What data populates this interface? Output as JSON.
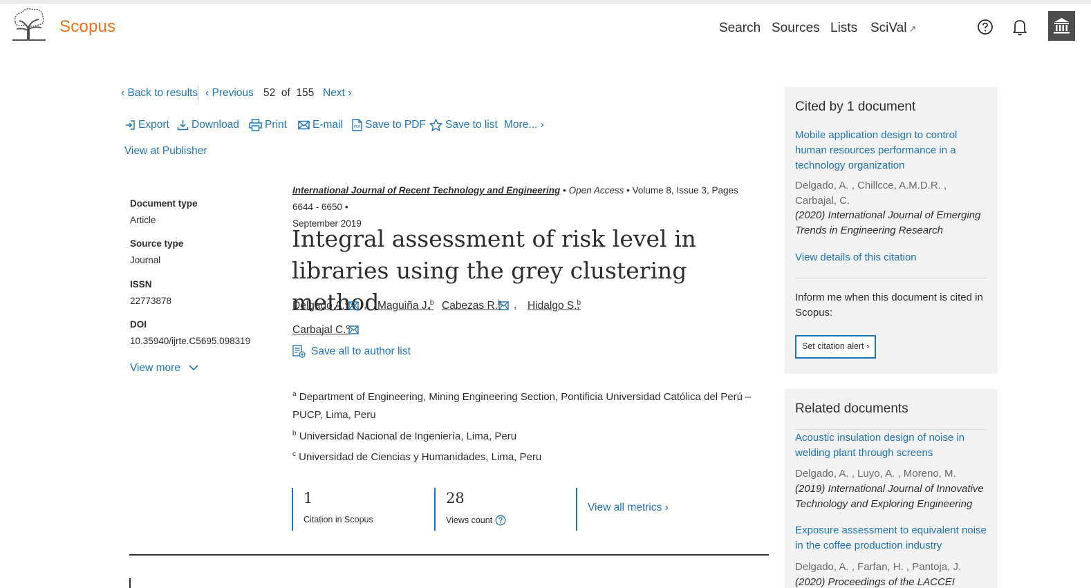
{
  "header": {
    "brand": "Scopus",
    "nav": {
      "search": "Search",
      "sources": "Sources",
      "lists": "Lists",
      "scival": "SciVal"
    },
    "scival_arrow": "↗",
    "icons": [
      "help-icon",
      "bell-icon",
      "institution-icon"
    ]
  },
  "results_nav": {
    "back": "‹ Back to results",
    "previous": "‹ Previous",
    "position": "52  of  155",
    "next": "Next ›"
  },
  "actions": {
    "export": "Export",
    "download": "Download",
    "print": "Print",
    "email": "E-mail",
    "save_pdf": "Save to PDF",
    "save_list": "Save to list",
    "more": "More... ›",
    "view_publisher": "View at Publisher"
  },
  "metadata": {
    "doc_type_label": "Document type",
    "doc_type": "Article",
    "source_type_label": "Source type",
    "source_type": "Journal",
    "issn_label": "ISSN",
    "issn": "22773878",
    "doi_label": "DOI",
    "doi": "10.35940/ijrte.C5695.098319",
    "view_more": "View more"
  },
  "source": {
    "journal": "International Journal of Recent Technology and Engineering",
    "bullet": "•",
    "open_access": "Open Access",
    "volume": "Volume 8, Issue 3, Pages 6644 - 6650",
    "date": "September 2019"
  },
  "title": "Integral assessment of risk level in libraries using the grey clustering method",
  "authors": [
    {
      "name": "Delgado A.",
      "sup": "a"
    },
    {
      "name": "Maguiña J.",
      "sup": "b"
    },
    {
      "name": "Cabezas R.",
      "sup": "b"
    },
    {
      "name": "Hidalgo S.",
      "sup": "b"
    },
    {
      "name": "Carbajal C.",
      "sup": "c"
    }
  ],
  "comma": ",",
  "save_all_authors": "Save all to author list",
  "affiliations": [
    {
      "sup": "a",
      "text": "Department of Engineering, Mining Engineering Section, Pontificia Universidad Católica del Perú – PUCP, Lima, Peru"
    },
    {
      "sup": "b",
      "text": "Universidad Nacional de Ingeniería, Lima, Peru"
    },
    {
      "sup": "c",
      "text": "Universidad de Ciencias y Humanidades, Lima, Peru"
    }
  ],
  "metrics": {
    "citations": "1",
    "citations_label": "Citation in Scopus",
    "views": "28",
    "views_label": "Views count",
    "view_all": "View all metrics ›"
  },
  "cited_by": {
    "heading": "Cited by 1 document",
    "doc_title": "Mobile application design to control human resources performance in a technology organization",
    "doc_authors": "Delgado, A. , Chillcce, A.M.D.R. , Carbajal, C.",
    "doc_source": "(2020) International Journal of Emerging Trends in Engineering Research",
    "view_details": "View details of this citation",
    "inform_text": "Inform me when this document is cited in Scopus:",
    "alert_button": "Set citation alert ›"
  },
  "related": {
    "heading": "Related documents",
    "items": [
      {
        "title": "Acoustic insulation design of noise in welding plant through screens",
        "authors": "Delgado, A. , Luyo, A. , Moreno, M.",
        "source": "(2019) International Journal of Innovative Technology and Exploring Engineering"
      },
      {
        "title": "Exposure assessment to equivalent noise in the coffee production industry",
        "authors": "Delgado, A. , Farfan, H. , Pantoja, J.",
        "source": "(2020) Proceedings of the LACCEI"
      }
    ]
  },
  "colors": {
    "brand": "#e9711c",
    "link": "#1f73b7",
    "text": "#2e2e2e",
    "panel": "#f2f2f2"
  }
}
